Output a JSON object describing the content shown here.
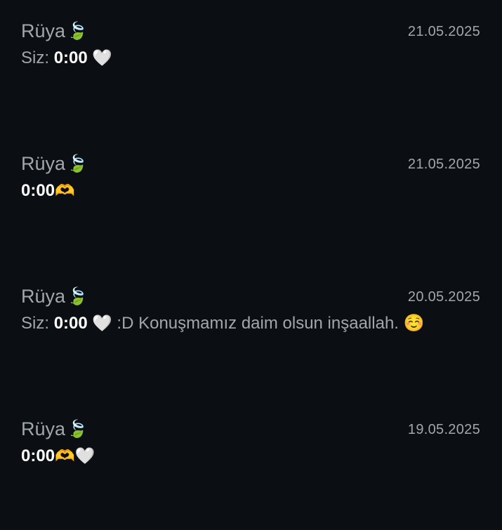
{
  "conversations": [
    {
      "name": "Rüya",
      "name_emoji": "🍃",
      "date": "21.05.2025",
      "sender_prefix": "Siz: ",
      "time_text": "0:00",
      "after_time": " 🤍",
      "message": ""
    },
    {
      "name": "Rüya",
      "name_emoji": "🍃",
      "date": "21.05.2025",
      "sender_prefix": "",
      "time_text": "0:00",
      "after_time": "🫶",
      "message": ""
    },
    {
      "name": "Rüya",
      "name_emoji": "🍃",
      "date": "20.05.2025",
      "sender_prefix": "Siz: ",
      "time_text": "0:00",
      "after_time": " 🤍",
      "message": "  :D  Konuşmamız daim olsun inşaallah. ☺️"
    },
    {
      "name": "Rüya",
      "name_emoji": "🍃",
      "date": "19.05.2025",
      "sender_prefix": "",
      "time_text": "0:00",
      "after_time": "🫶🤍",
      "message": ""
    }
  ],
  "icons": {
    "name_icon": "leaf-icon"
  },
  "colors": {
    "background": "#0b0f13",
    "secondary_text": "#a2a7ad",
    "primary_text": "#ffffff"
  }
}
